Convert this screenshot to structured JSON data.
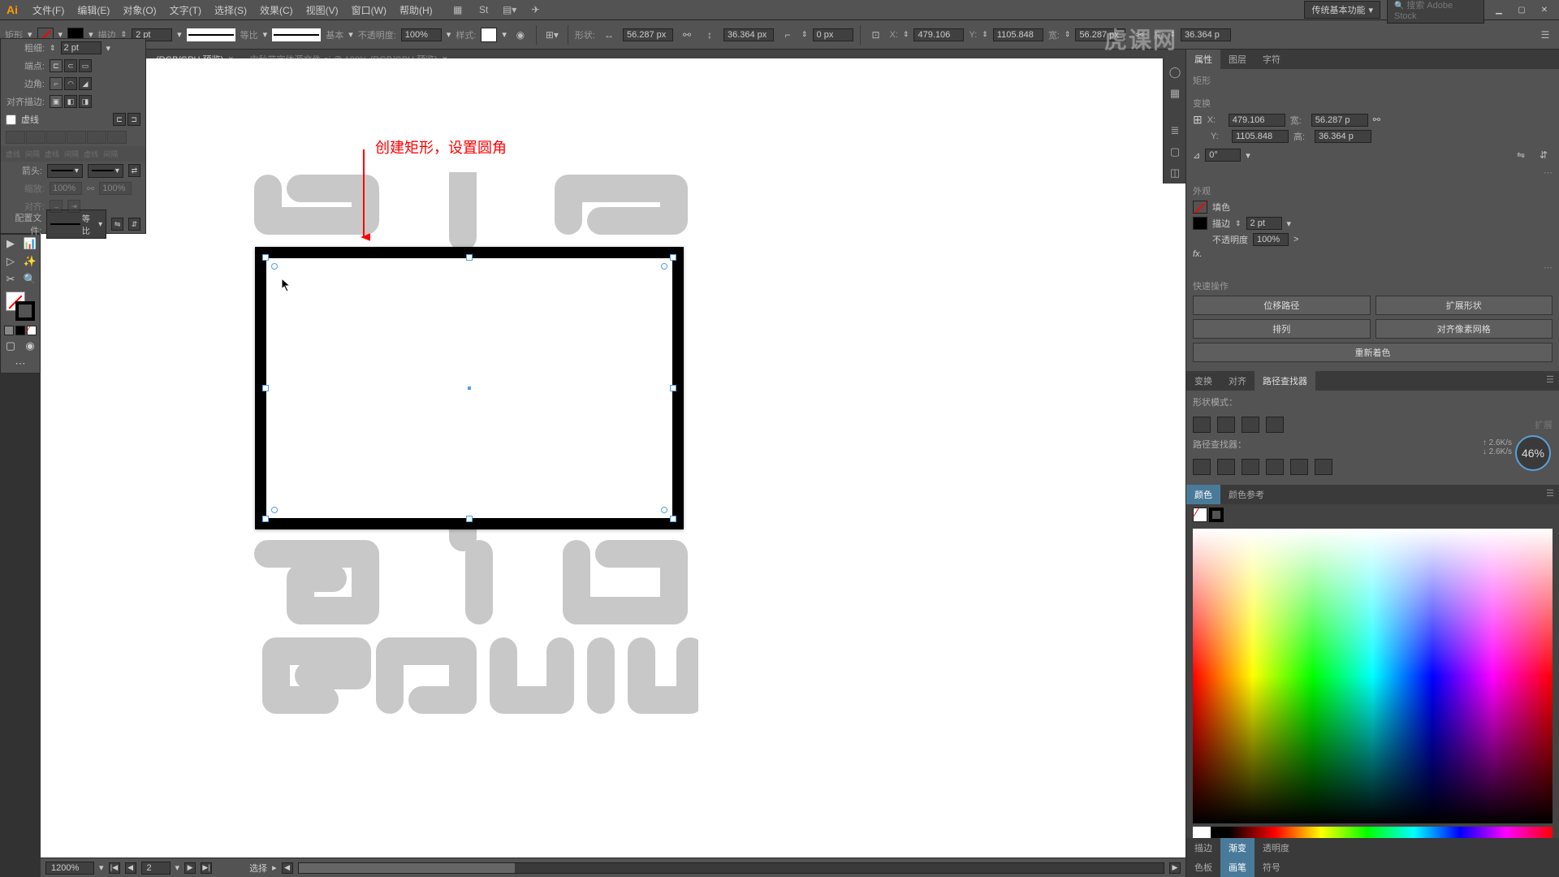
{
  "menu": {
    "file": "文件(F)",
    "edit": "编辑(E)",
    "object": "对象(O)",
    "type": "文字(T)",
    "select": "选择(S)",
    "effect": "效果(C)",
    "view": "视图(V)",
    "window": "窗口(W)",
    "help": "帮助(H)"
  },
  "workspace": "传统基本功能",
  "search_placeholder": "搜索 Adobe Stock",
  "control": {
    "shape_label": "矩形",
    "stroke_label": "描边",
    "stroke_weight": "2 pt",
    "stroke_style": "等比",
    "profile": "基本",
    "opacity_label": "不透明度:",
    "opacity": "100%",
    "style_label": "样式:",
    "shape_type_label": "形状:",
    "x_label": "X:",
    "x": "479.106",
    "y_label": "Y:",
    "y": "1105.848",
    "w_label": "宽:",
    "w": "56.287 px",
    "h_label": "高:",
    "h": "36.364 p",
    "topW": "56.287 px",
    "topH": "36.364 px",
    "corner": "0 px"
  },
  "tabs": {
    "tab1": "(RGB/GPU 预览)",
    "tab2": "中秋节字体源文件.ai @ 100% (RGB/GPU 预览)"
  },
  "stroke_panel": {
    "weight_label": "粗细:",
    "weight": "2 pt",
    "cap_label": "端点:",
    "corner_label": "边角:",
    "align_label": "对齐描边:",
    "dashed": "虚线",
    "arrow_label": "箭头:",
    "scale_label": "缩放:",
    "scale": "100%",
    "align2_label": "对齐:",
    "profile_label": "配置文件:",
    "profile": "等比",
    "faded": [
      "虚线",
      "间隔",
      "虚线",
      "间隔",
      "虚线",
      "间隔"
    ]
  },
  "annotation": "创建矩形，设置圆角",
  "right": {
    "tabs": {
      "props": "属性",
      "layers": "图层",
      "chars": "字符"
    },
    "shape_heading": "矩形",
    "transform": "变换",
    "x_label": "X:",
    "x": "479.106",
    "w_label": "宽:",
    "w": "56.287 p",
    "y_label": "Y:",
    "y": "1105.848",
    "h_label": "高:",
    "h": "36.364 p",
    "angle": "0°",
    "appearance": "外观",
    "fill_label": "填色",
    "stroke_label": "描边",
    "stroke_w": "2 pt",
    "opacity_label": "不透明度",
    "opacity": "100%",
    "fx": "fx.",
    "quick_heading": "快速操作",
    "btn1": "位移路径",
    "btn2": "扩展形状",
    "btn3": "排列",
    "btn4": "对齐像素网格",
    "btn5": "重新着色",
    "tf_tabs": {
      "transform": "变换",
      "align": "对齐",
      "pathfinder": "路径查找器"
    },
    "shape_mode": "形状模式：",
    "pathfinder_label": "路径查找器：",
    "expand": "扩展",
    "color_tabs": {
      "color": "颜色",
      "guide": "颜色参考"
    },
    "grad_tabs": {
      "stroke": "描边",
      "gradient": "渐变",
      "transp": "透明度"
    },
    "swatch_tabs": {
      "swatches": "色板",
      "brushes": "画笔",
      "symbols": "符号"
    }
  },
  "bottom": {
    "zoom": "1200%",
    "artboard": "2",
    "tool": "选择"
  },
  "badge": {
    "pct": "46%",
    "up": "2.6K/s",
    "down": "2.6K/s"
  },
  "watermark": "虎课网"
}
